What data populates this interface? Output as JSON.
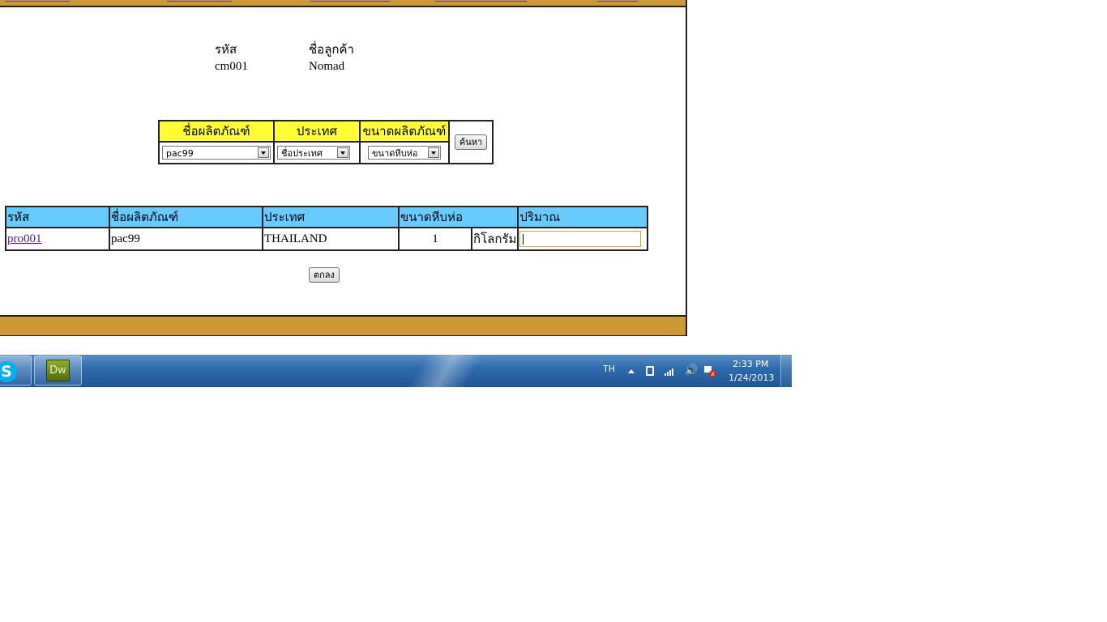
{
  "customer": {
    "id_label": "รหัส",
    "name_label": "ชื่อลูกค้า",
    "id_value": "cm001",
    "name_value": "Nomad"
  },
  "search": {
    "headers": [
      "ชื่อผลิตภัณฑ์",
      "ประเทศ",
      "ขนาดผลิตภัณฑ์"
    ],
    "product_value": "pac99",
    "country_value": "ชื่อประเทศ",
    "size_value": "ขนาดหีบห่อ",
    "button_label": "ค้นหา"
  },
  "results": {
    "headers": [
      "รหัส",
      "ชื่อผลิตภัณฑ์",
      "ประเทศ",
      "ขนาดหีบห่อ",
      "ปริมาณ"
    ],
    "rows": [
      {
        "code": "pro001",
        "product": "pac99",
        "country": "THAILAND",
        "size": "1",
        "unit": "กิโลกรัม",
        "quantity": ""
      }
    ]
  },
  "submit_label": "ตกลง",
  "taskbar": {
    "apps": [
      {
        "name": "Skype",
        "icon": "skype-icon",
        "color": "#00aff0"
      },
      {
        "name": "Dreamweaver",
        "label": "Dw",
        "icon": "dreamweaver-icon",
        "color": "#6a8a1f"
      }
    ],
    "language": "TH",
    "time": "2:33 PM",
    "date": "1/24/2013"
  },
  "colors": {
    "header_bar": "#cc9933",
    "search_header": "#ffff33",
    "results_header": "#66ccff",
    "link": "#551a8b"
  }
}
